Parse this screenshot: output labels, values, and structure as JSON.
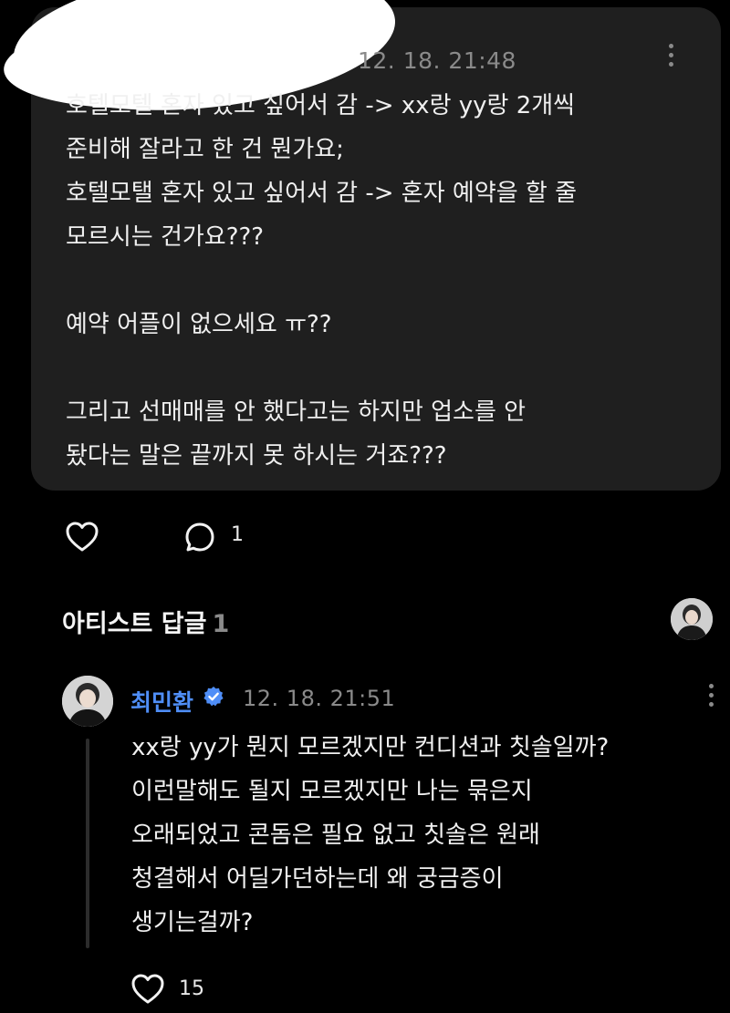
{
  "post": {
    "timestamp": "12. 18. 21:48",
    "text": "호텔모텔 혼자 있고 싶어서 감 -> xx랑 yy랑 2개씩\n준비해 잘라고 한 건 뭔가요;\n호텔모탤 혼자 있고 싶어서 감 -> 혼자 예약을 할 줄\n모르시는 건가요???\n\n예약 어플이 없으세요 ㅠ??\n\n그리고 선매매를 안 했다고는 하지만 업소를 안\n돴다는 말은 끝까지 못 하시는 거죠???",
    "comment_count": "1"
  },
  "section": {
    "title": "아티스트 답글",
    "count": "1"
  },
  "reply": {
    "author": "최민환",
    "timestamp": "12. 18. 21:51",
    "text": "xx랑 yy가 뭔지 모르겠지만 컨디션과 칫솔일까?\n이런말해도 될지 모르겠지만 나는 묶은지\n오래되었고 콘돔은 필요 없고 칫솔은 원래\n청결해서 어딜가던하는데 왜 궁금증이\n생기는걸까?",
    "like_count": "15"
  },
  "colors": {
    "background": "#000000",
    "card": "#1f1f1f",
    "accent_name": "#4f8ef7",
    "muted": "#8a8a8a"
  },
  "icons": [
    "heart-icon",
    "comment-bubble-icon",
    "more-options-icon",
    "verified-badge-icon"
  ]
}
